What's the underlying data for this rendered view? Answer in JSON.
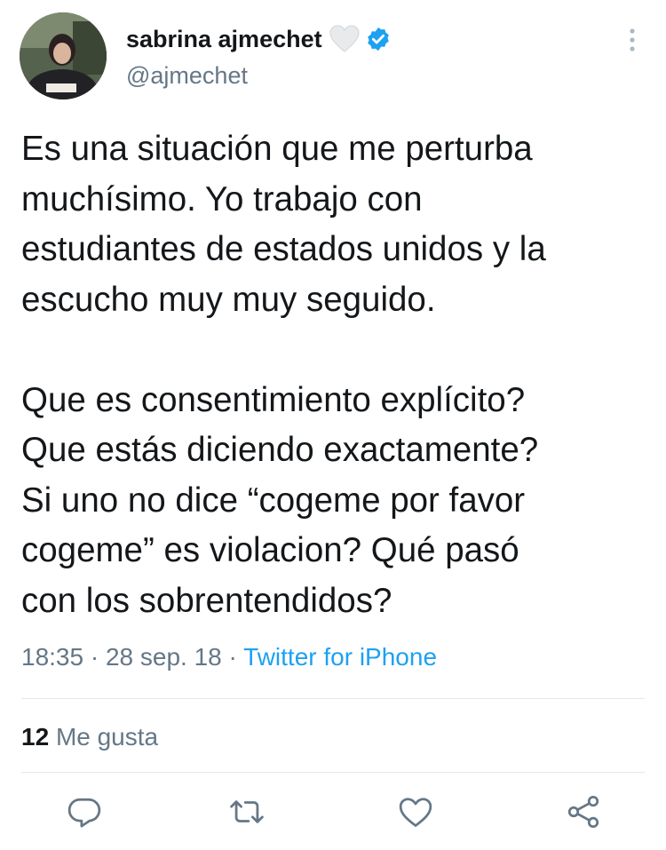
{
  "user": {
    "display_name": "sabrina ajmechet",
    "handle": "@ajmechet"
  },
  "tweet": {
    "paragraph1": [
      "Es una situación que me perturba",
      "muchísimo. Yo trabajo con",
      "estudiantes de estados unidos y la",
      "escucho muy muy seguido."
    ],
    "paragraph2": [
      "Que es consentimiento explícito?",
      "Que estás diciendo exactamente?",
      "Si uno no dice “cogeme por favor",
      "cogeme” es violacion? Qué pasó",
      "con los sobrentendidos?"
    ]
  },
  "meta": {
    "time": "18:35",
    "separator": " · ",
    "date": "28 sep. 18",
    "source": "Twitter for iPhone"
  },
  "stats": {
    "likes_count": "12",
    "likes_label": "Me gusta"
  },
  "icons": {
    "verified": "verified-badge-icon",
    "heart_emoji": "white-heart-emoji",
    "more": "more-vertical-icon",
    "reply": "reply-icon",
    "retweet": "retweet-icon",
    "like": "like-icon",
    "share": "share-icon"
  },
  "colors": {
    "text": "#14171a",
    "secondary": "#657786",
    "accent": "#1da1f2",
    "divider": "#e1e8ed"
  }
}
